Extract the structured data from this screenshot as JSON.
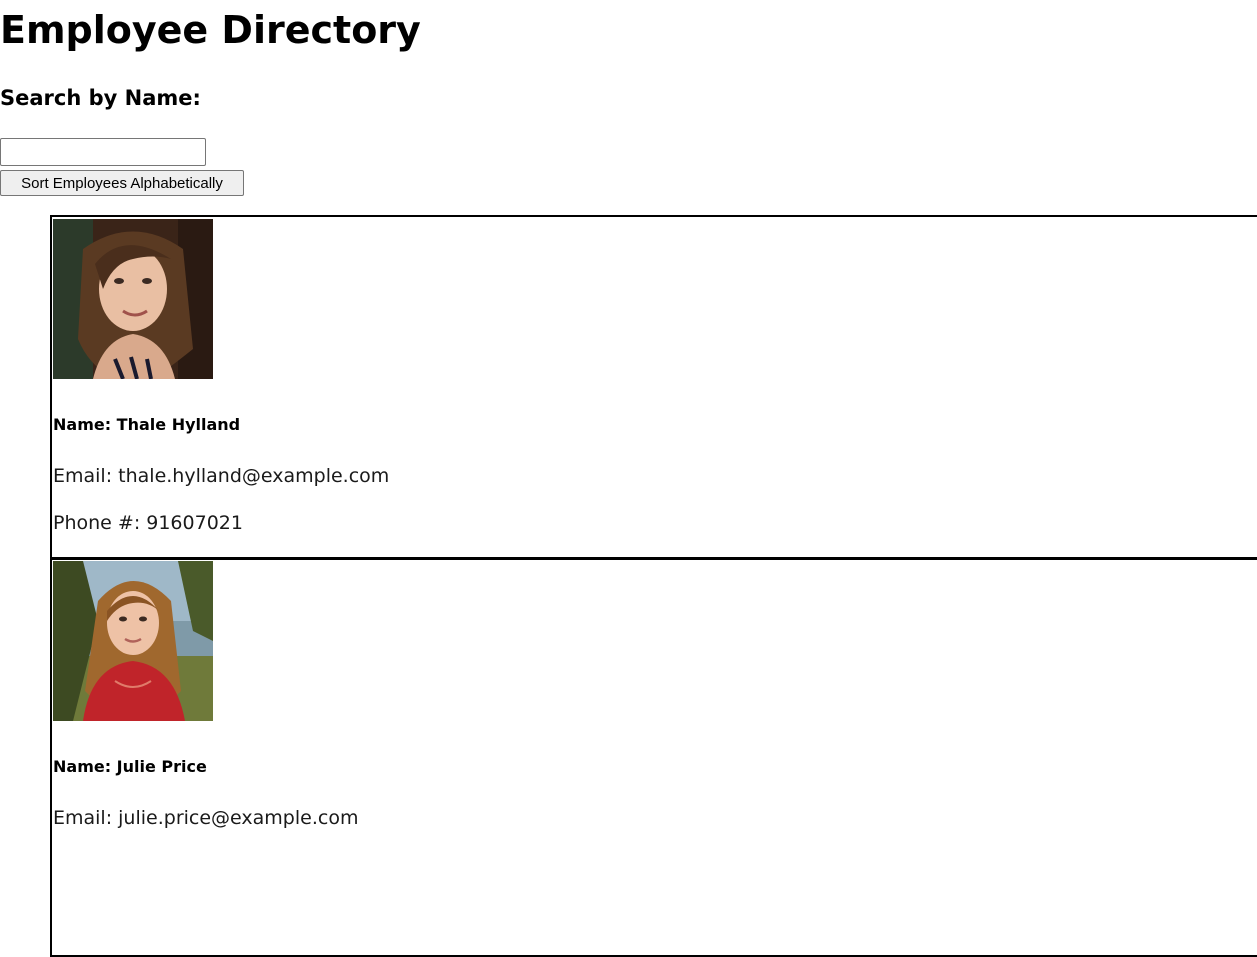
{
  "page": {
    "title": "Employee Directory",
    "search_label": "Search by Name:",
    "search_value": "",
    "search_placeholder": "",
    "sort_button_label": "Sort Employees Alphabetically"
  },
  "employees": [
    {
      "name_label": "Name: Thale Hylland",
      "email_label": "Email: thale.hylland@example.com",
      "phone_label": "Phone #: 91607021",
      "photo": "portrait-photo"
    },
    {
      "name_label": "Name: Julie Price",
      "email_label": "Email: julie.price@example.com",
      "photo": "portrait-photo"
    }
  ]
}
